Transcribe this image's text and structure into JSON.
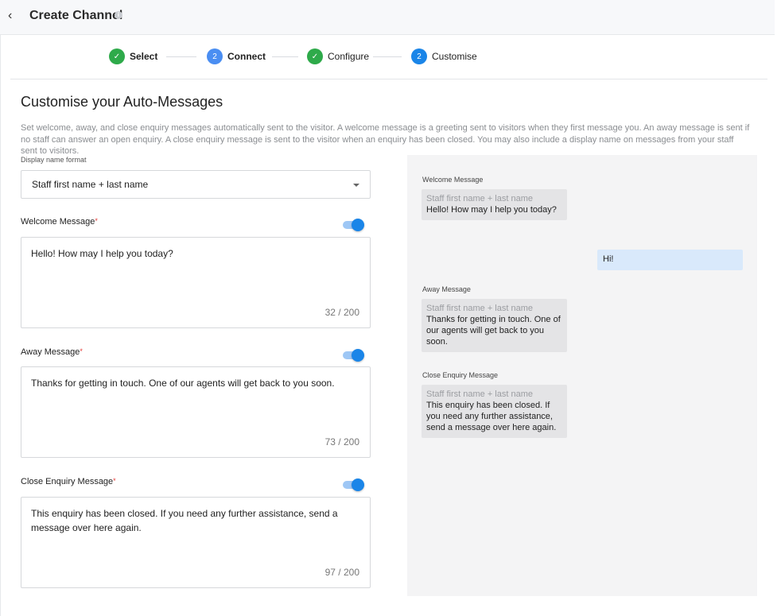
{
  "header": {
    "title": "Create Channel",
    "back_icon": "chevron-left-icon",
    "info_icon": "info-icon"
  },
  "stepper": {
    "steps": [
      {
        "label": "Select",
        "state": "done",
        "marker": "✓"
      },
      {
        "label": "Connect",
        "state": "number",
        "marker": "2"
      },
      {
        "label": "Configure",
        "state": "done",
        "marker": "✓"
      },
      {
        "label": "Customise",
        "state": "current",
        "marker": "2"
      }
    ]
  },
  "main": {
    "title": "Customise your Auto-Messages",
    "description": "Set welcome, away, and close enquiry messages automatically sent to the visitor. A welcome message is a greeting sent to visitors when they first message you. An away message is sent if no staff can answer an open enquiry. A close enquiry message is sent to the visitor when an enquiry has been closed. You may also include a display name on messages from your staff sent to visitors.",
    "display_name_label": "Display name format",
    "display_name_value": "Staff first name + last name",
    "required_mark": "*",
    "welcome": {
      "label": "Welcome Message",
      "enabled": true,
      "text": "Hello! How may I help you today?",
      "counter": "32 / 200"
    },
    "away": {
      "label": "Away Message",
      "enabled": true,
      "text": "Thanks for getting in touch. One of our agents will get back to you soon.",
      "counter": "73 / 200"
    },
    "close": {
      "label": "Close Enquiry Message",
      "enabled": true,
      "text": "This enquiry has been closed. If you need any further assistance, send a message over here again.",
      "counter": "97 / 200"
    }
  },
  "preview": {
    "welcome_label": "Welcome Message",
    "away_label": "Away Message",
    "close_label": "Close Enquiry Message",
    "sender_name": "Staff first name + last name",
    "welcome_text": "Hello! How may I help you today?",
    "user_reply": "Hi!",
    "away_text": "Thanks for getting in touch. One of our agents will get back to you soon.",
    "close_text": "This enquiry has been closed. If you need any further assistance, send a message over here again."
  },
  "colors": {
    "accent": "#1a85e8",
    "success": "#2eaa4a",
    "required": "#e53935"
  }
}
